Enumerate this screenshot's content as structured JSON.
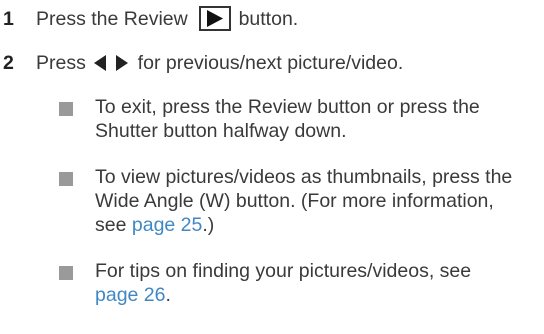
{
  "steps": [
    {
      "number": "1",
      "before": "Press the Review",
      "icon": "review-play-icon",
      "after": "button."
    },
    {
      "number": "2",
      "before": "Press",
      "icon": "left-right-arrows-icon",
      "after": "for previous/next picture/video."
    }
  ],
  "bullets": [
    {
      "line1": "To exit, press the Review button or press the",
      "line2": "Shutter button halfway down."
    },
    {
      "line1": "To view pictures/videos as thumbnails, press the",
      "line2": "Wide Angle (W) button. (For more information,",
      "line3_before": "see",
      "line3_link": "page 25",
      "line3_after": ".)"
    },
    {
      "line1": "For tips on finding your pictures/videos, see",
      "line2_link": "page 26",
      "line2_after": "."
    }
  ],
  "colors": {
    "text": "#3a3a3a",
    "link": "#3f88c5",
    "bullet": "#9a9a9a"
  }
}
